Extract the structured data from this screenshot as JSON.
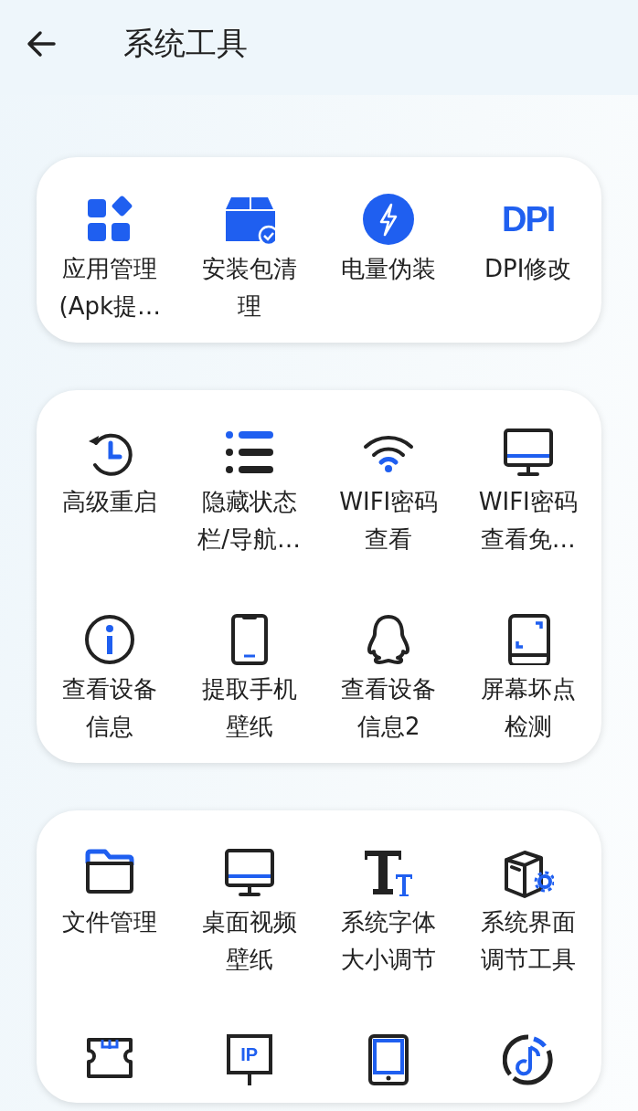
{
  "header": {
    "title": "系统工具"
  },
  "cards": [
    {
      "tools": [
        {
          "label": "应用管理(Apk提…"
        },
        {
          "label": "安装包清理"
        },
        {
          "label": "电量伪装"
        },
        {
          "icon_text": "DPI",
          "label": "DPI修改"
        }
      ]
    },
    {
      "tools": [
        {
          "label": "高级重启"
        },
        {
          "label": "隐藏状态栏/导航…"
        },
        {
          "label": "WIFI密码查看"
        },
        {
          "label": "WIFI密码查看免…"
        },
        {
          "label": "查看设备信息"
        },
        {
          "label": "提取手机壁纸"
        },
        {
          "label": "查看设备信息2"
        },
        {
          "label": "屏幕坏点检测"
        }
      ]
    },
    {
      "tools": [
        {
          "label": "文件管理"
        },
        {
          "label": "桌面视频壁纸"
        },
        {
          "label": "系统字体大小调节"
        },
        {
          "label": "系统界面调节工具"
        },
        {
          "icon_text": "IP"
        }
      ]
    }
  ]
}
